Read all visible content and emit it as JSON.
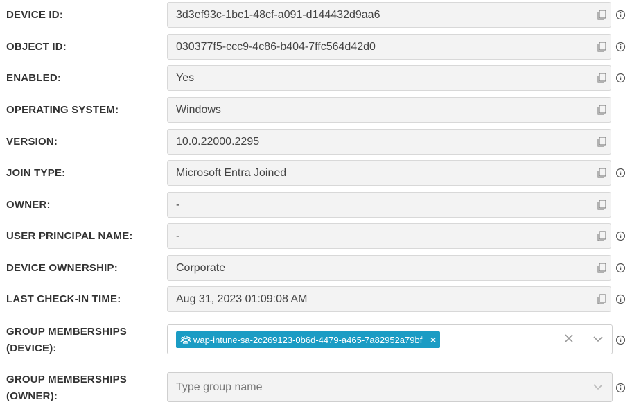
{
  "fields": [
    {
      "label": "DEVICE ID:",
      "value": "3d3ef93c-1bc1-48cf-a091-d144432d9aa6",
      "info": true
    },
    {
      "label": "OBJECT ID:",
      "value": "030377f5-ccc9-4c86-b404-7ffc564d42d0",
      "info": true
    },
    {
      "label": "ENABLED:",
      "value": "Yes",
      "info": true
    },
    {
      "label": "OPERATING SYSTEM:",
      "value": "Windows",
      "info": false
    },
    {
      "label": "VERSION:",
      "value": "10.0.22000.2295",
      "info": false
    },
    {
      "label": "JOIN TYPE:",
      "value": "Microsoft Entra Joined",
      "info": true
    },
    {
      "label": "OWNER:",
      "value": "-",
      "info": false
    },
    {
      "label": "USER PRINCIPAL NAME:",
      "value": "-",
      "info": true
    },
    {
      "label": "DEVICE OWNERSHIP:",
      "value": "Corporate",
      "info": true
    },
    {
      "label": "LAST CHECK-IN TIME:",
      "value": "Aug 31, 2023 01:09:08 AM",
      "info": true
    }
  ],
  "group_device": {
    "label_line1": "GROUP MEMBERSHIPS",
    "label_line2": "(DEVICE):",
    "chip": "wap-intune-sa-2c269123-0b6d-4479-a465-7a82952a79bf",
    "chip_remove": "×"
  },
  "group_owner": {
    "label_line1": "GROUP MEMBERSHIPS",
    "label_line2": "(OWNER):",
    "placeholder": "Type group name"
  },
  "colors": {
    "chip": "#1b9cc4",
    "field_bg": "#f3f3f3"
  },
  "icons": {
    "copy": "copy-icon",
    "info": "info-icon",
    "group": "group-icon",
    "clear": "clear-icon",
    "dropdown": "chevron-down-icon"
  }
}
